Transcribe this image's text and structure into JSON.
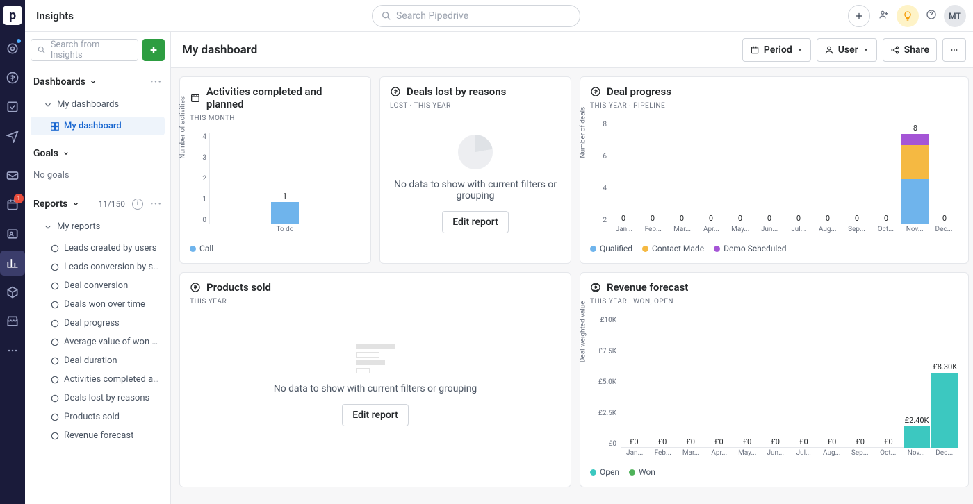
{
  "topbar": {
    "title": "Insights",
    "search_placeholder": "Search Pipedrive",
    "avatar_initials": "MT"
  },
  "sidebar": {
    "search_placeholder": "Search from Insights",
    "dashboards_label": "Dashboards",
    "my_dashboards_label": "My dashboards",
    "my_dashboard_label": "My dashboard",
    "goals_label": "Goals",
    "no_goals": "No goals",
    "reports_label": "Reports",
    "reports_count": "11/150",
    "my_reports_label": "My reports",
    "reports": [
      "Leads created by users",
      "Leads conversion by so...",
      "Deal conversion",
      "Deals won over time",
      "Deal progress",
      "Average value of won d...",
      "Deal duration",
      "Activities completed an...",
      "Deals lost by reasons",
      "Products sold",
      "Revenue forecast"
    ]
  },
  "content_header": {
    "title": "My dashboard",
    "period_label": "Period",
    "user_label": "User",
    "share_label": "Share"
  },
  "cards": {
    "activities": {
      "title": "Activities completed and planned",
      "sub": "THIS MONTH"
    },
    "deals_lost": {
      "title": "Deals lost by reasons",
      "sub": "LOST  ·  THIS YEAR",
      "nodata_msg": "No data to show with current filters or grouping",
      "edit_label": "Edit report"
    },
    "deal_progress": {
      "title": "Deal progress",
      "sub": "THIS YEAR  ·  PIPELINE"
    },
    "products": {
      "title": "Products sold",
      "sub": "THIS YEAR",
      "nodata_msg": "No data to show with current filters or grouping",
      "edit_label": "Edit report"
    },
    "revenue": {
      "title": "Revenue forecast",
      "sub": "THIS YEAR  ·  WON, OPEN"
    }
  },
  "chart_data": [
    {
      "id": "activities",
      "type": "bar",
      "title": "Activities completed and planned",
      "xlabel": "",
      "ylabel": "Number of activities",
      "ylim": [
        0,
        4
      ],
      "yticks": [
        0,
        1,
        2,
        3,
        4
      ],
      "categories": [
        "To do"
      ],
      "series": [
        {
          "name": "Call",
          "color": "#6fb4ec",
          "values": [
            1
          ]
        }
      ],
      "data_labels": [
        "1"
      ]
    },
    {
      "id": "deal_progress",
      "type": "bar",
      "title": "Deal progress",
      "xlabel": "",
      "ylabel": "Number of deals",
      "ylim": [
        0,
        8
      ],
      "yticks": [
        2,
        4,
        6,
        8
      ],
      "categories": [
        "Jan...",
        "Feb...",
        "Mar...",
        "Apr...",
        "May...",
        "Jun...",
        "Jul...",
        "Aug...",
        "Sep...",
        "Oct...",
        "Nov...",
        "Dec..."
      ],
      "series": [
        {
          "name": "Qualified",
          "color": "#6fb4ec",
          "values": [
            0,
            0,
            0,
            0,
            0,
            0,
            0,
            0,
            0,
            0,
            4,
            0
          ]
        },
        {
          "name": "Contact Made",
          "color": "#f5b942",
          "values": [
            0,
            0,
            0,
            0,
            0,
            0,
            0,
            0,
            0,
            0,
            3,
            0
          ]
        },
        {
          "name": "Demo Scheduled",
          "color": "#a555d6",
          "values": [
            0,
            0,
            0,
            0,
            0,
            0,
            0,
            0,
            0,
            0,
            1,
            0
          ]
        }
      ],
      "totals": [
        0,
        0,
        0,
        0,
        0,
        0,
        0,
        0,
        0,
        0,
        8,
        0
      ],
      "data_labels": [
        "0",
        "0",
        "0",
        "0",
        "0",
        "0",
        "0",
        "0",
        "0",
        "0",
        "8",
        "0"
      ]
    },
    {
      "id": "revenue",
      "type": "bar",
      "title": "Revenue forecast",
      "xlabel": "",
      "ylabel": "Deal weighted value",
      "ylim": [
        0,
        10000
      ],
      "yticks_labels": [
        "£0",
        "£2.5K",
        "£5.0K",
        "£7.5K",
        "£10K"
      ],
      "categories": [
        "Jan...",
        "Feb...",
        "Mar...",
        "Apr...",
        "May...",
        "Jun...",
        "Jul...",
        "Aug...",
        "Sep...",
        "Oct...",
        "Nov...",
        "Dec..."
      ],
      "series": [
        {
          "name": "Open",
          "color": "#3cc8c0",
          "values": [
            0,
            0,
            0,
            0,
            0,
            0,
            0,
            0,
            0,
            0,
            2400,
            8300
          ]
        },
        {
          "name": "Won",
          "color": "#4fb25a",
          "values": [
            0,
            0,
            0,
            0,
            0,
            0,
            0,
            0,
            0,
            0,
            0,
            0
          ]
        }
      ],
      "totals": [
        0,
        0,
        0,
        0,
        0,
        0,
        0,
        0,
        0,
        0,
        2400,
        8300
      ],
      "data_labels": [
        "£0",
        "£0",
        "£0",
        "£0",
        "£0",
        "£0",
        "£0",
        "£0",
        "£0",
        "£0",
        "£2.40K",
        "£8.30K"
      ]
    }
  ],
  "nav_badge": "1"
}
